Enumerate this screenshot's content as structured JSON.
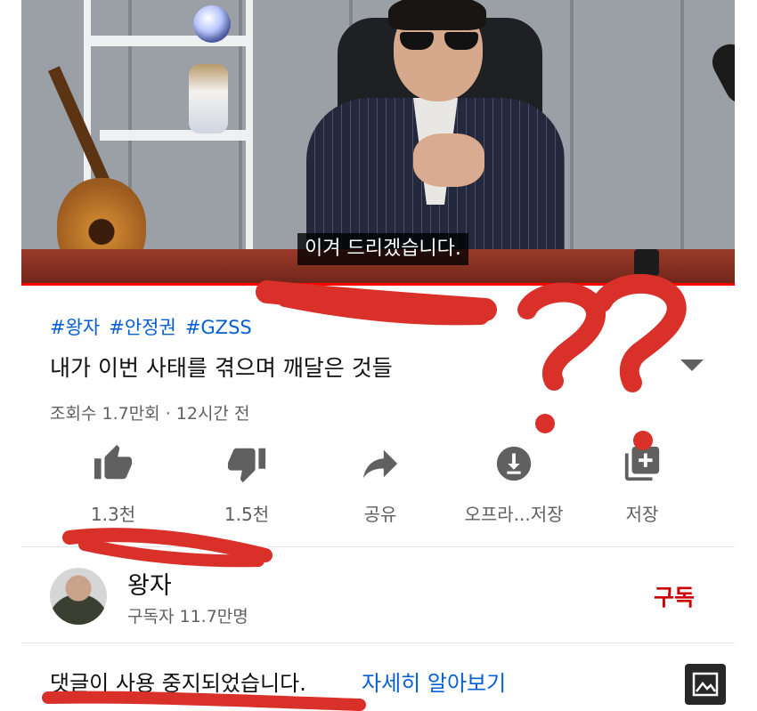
{
  "video": {
    "subtitle": "이겨 드리겠습니다.",
    "progress_fraction": 1.0,
    "accent_color": "#ff0000"
  },
  "details": {
    "hashtags": [
      "#왕자",
      "#안정권",
      "#GZSS"
    ],
    "title": "내가 이번 사태를 겪으며 깨달은 것들",
    "meta": "조회수 1.7만회 · 12시간 전",
    "expand_icon": "chevron-down-icon"
  },
  "actions": [
    {
      "icon": "thumbs-up-icon",
      "label": "1.3천"
    },
    {
      "icon": "thumbs-down-icon",
      "label": "1.5천"
    },
    {
      "icon": "share-icon",
      "label": "공유"
    },
    {
      "icon": "download-icon",
      "label": "오프라...저장"
    },
    {
      "icon": "add-to-playlist-icon",
      "label": "저장"
    }
  ],
  "channel": {
    "name": "왕자",
    "subscribers": "구독자 11.7만명",
    "subscribe_label": "구독",
    "subscribe_color": "#cc0000"
  },
  "comments": {
    "disabled_text": "댓글이 사용 중지되었습니다.",
    "learn_more": "자세히 알아보기",
    "link_color": "#065fd4"
  },
  "annotation_color": "#d9302a"
}
